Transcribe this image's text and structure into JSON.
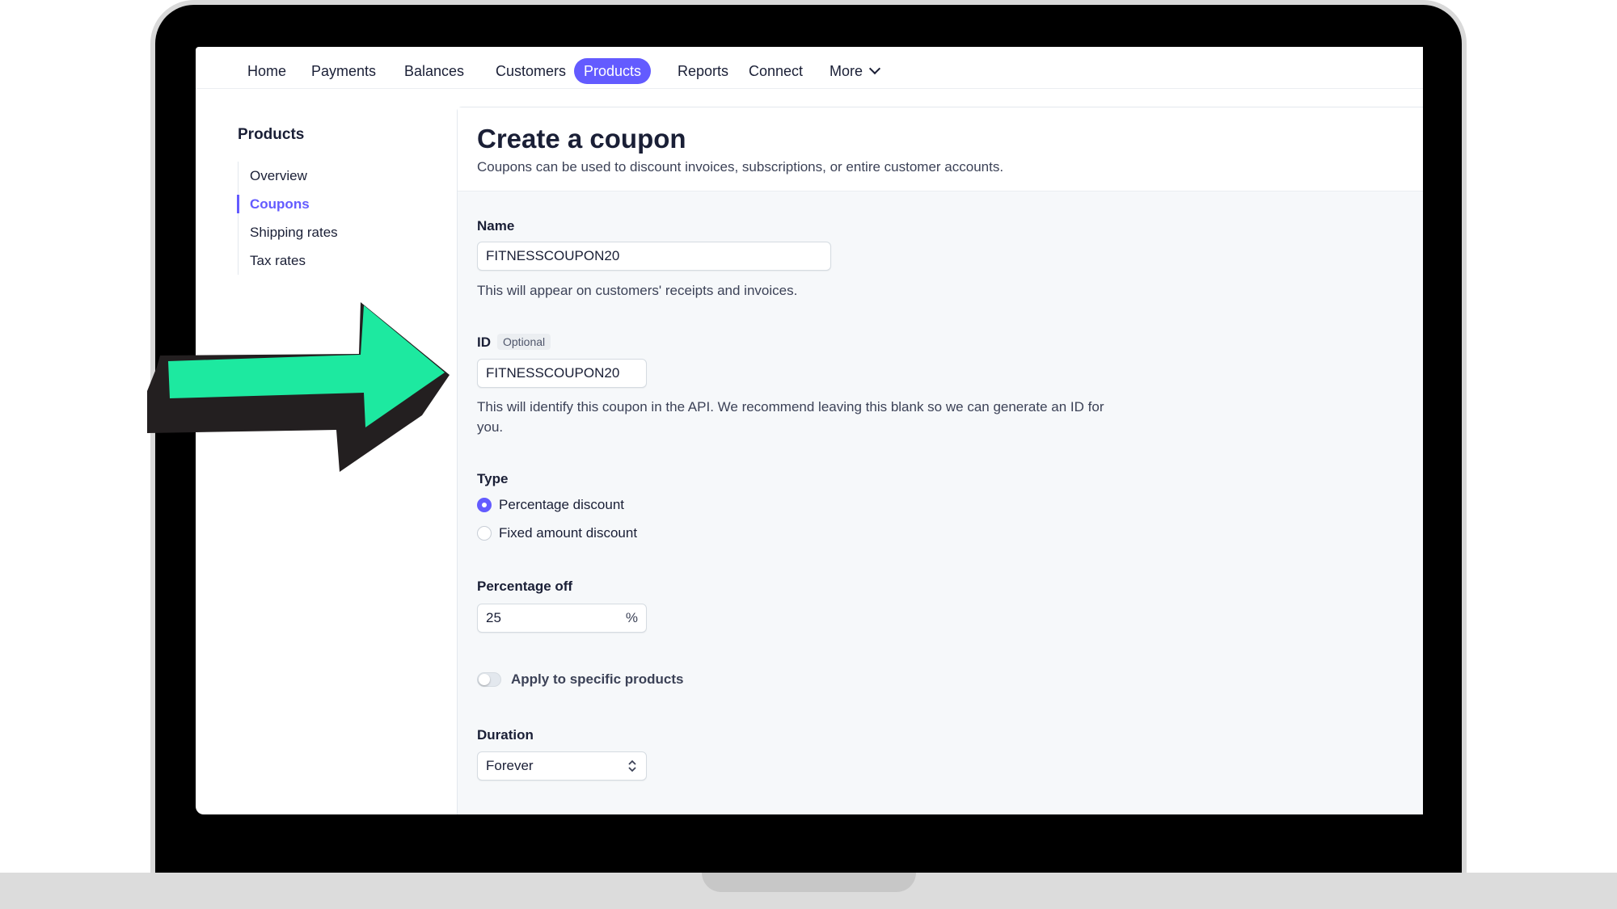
{
  "nav": {
    "items": [
      {
        "label": "Home"
      },
      {
        "label": "Payments"
      },
      {
        "label": "Balances"
      },
      {
        "label": "Customers"
      },
      {
        "label": "Products",
        "active": true
      },
      {
        "label": "Reports"
      },
      {
        "label": "Connect"
      },
      {
        "label": "More"
      }
    ]
  },
  "sidebar": {
    "title": "Products",
    "items": [
      {
        "label": "Overview"
      },
      {
        "label": "Coupons",
        "active": true
      },
      {
        "label": "Shipping rates"
      },
      {
        "label": "Tax rates"
      }
    ]
  },
  "form": {
    "title": "Create a coupon",
    "subtitle": "Coupons can be used to discount invoices, subscriptions, or entire customer accounts.",
    "name": {
      "label": "Name",
      "value": "FITNESSCOUPON20",
      "help": "This will appear on customers' receipts and invoices."
    },
    "id": {
      "label": "ID",
      "badge": "Optional",
      "value": "FITNESSCOUPON20",
      "help_line1": "This will identify this coupon in the API. We recommend leaving this blank so we can generate an ID for",
      "help_line2": "you."
    },
    "type": {
      "label": "Type",
      "options": [
        {
          "label": "Percentage discount",
          "selected": true
        },
        {
          "label": "Fixed amount discount",
          "selected": false
        }
      ]
    },
    "percentage_off": {
      "label": "Percentage off",
      "value": "25",
      "suffix": "%"
    },
    "apply_specific": {
      "label": "Apply to specific products",
      "on": false
    },
    "duration": {
      "label": "Duration",
      "value": "Forever"
    }
  },
  "colors": {
    "accent": "#635bff",
    "arrow_fill": "#1de9a0",
    "arrow_outline": "#231f20"
  },
  "icons": [
    "chevron-down-icon",
    "select-updown-icon",
    "arrow-pointer-icon"
  ]
}
